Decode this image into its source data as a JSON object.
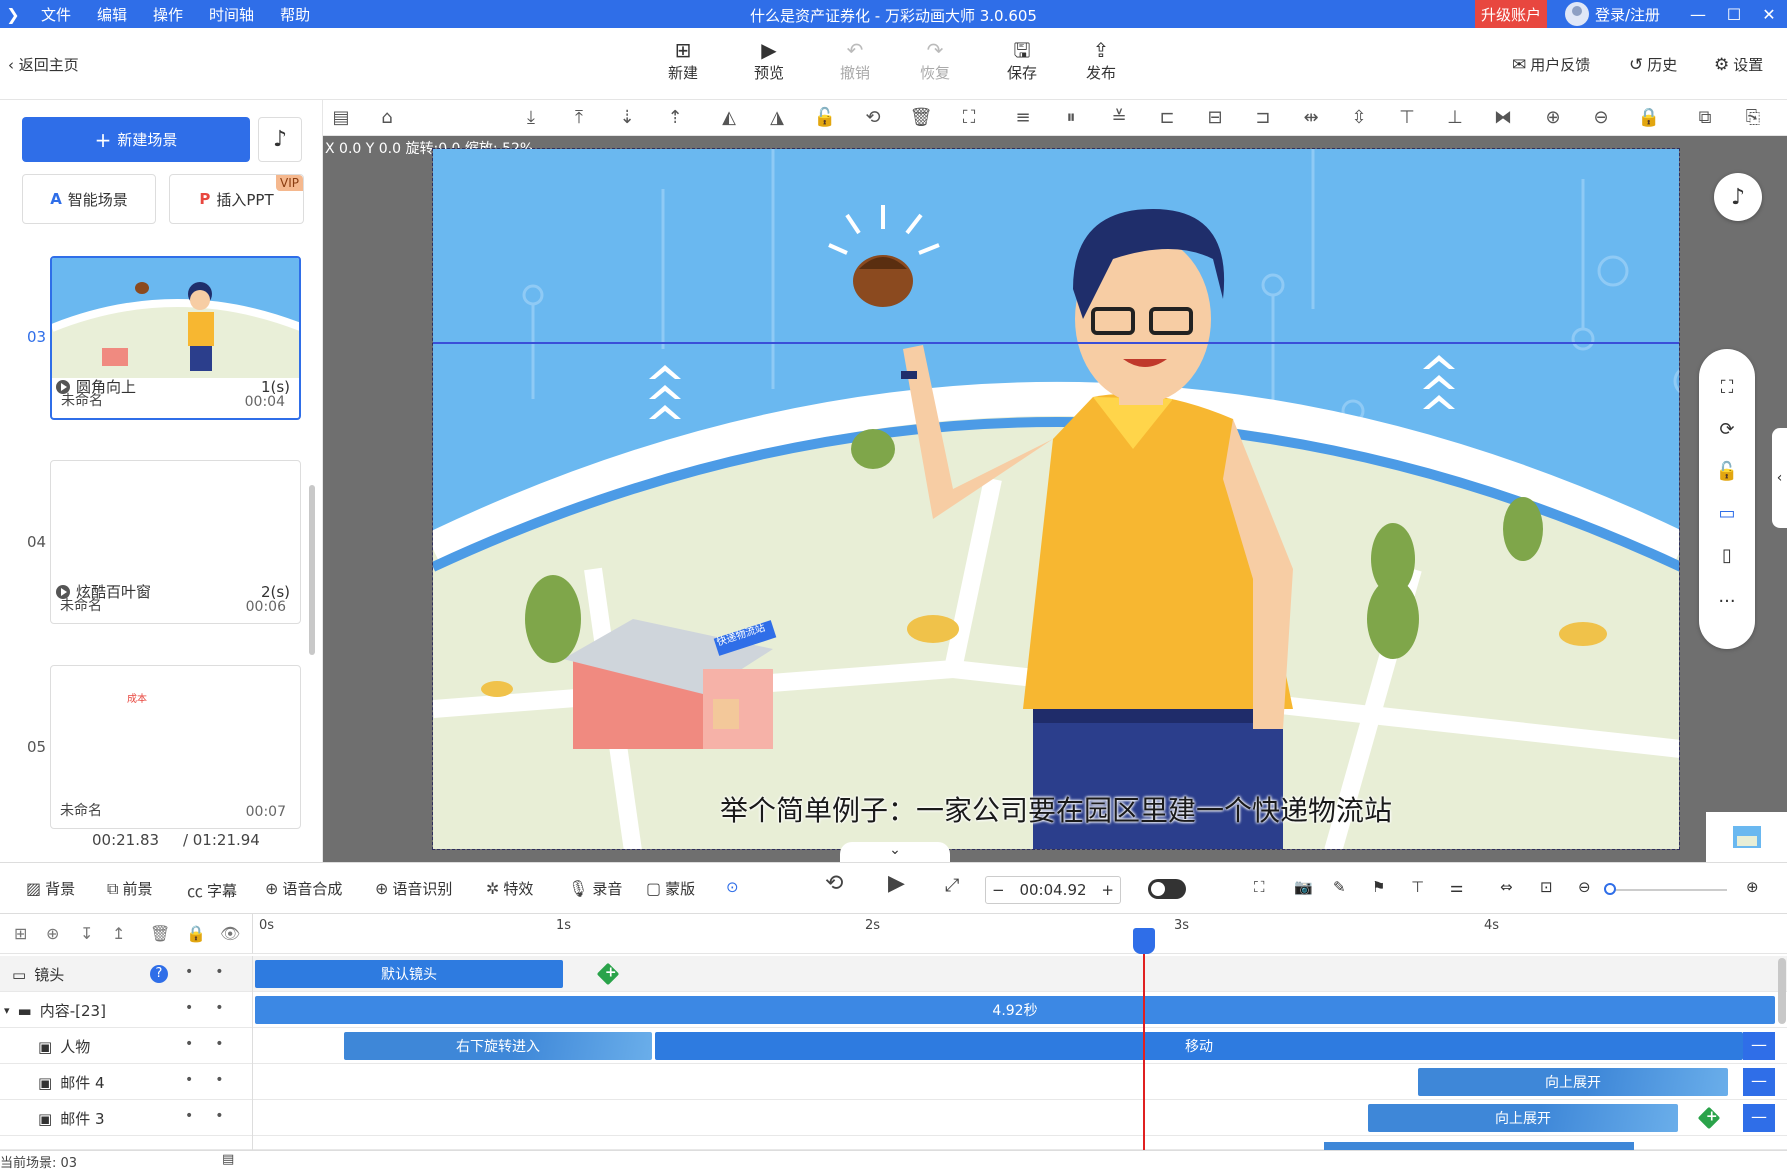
{
  "window": {
    "title": "什么是资产证券化 - 万彩动画大师 3.0.605",
    "menu": [
      "文件",
      "编辑",
      "操作",
      "时间轴",
      "帮助"
    ],
    "upgrade": "升级账户",
    "login": "登录/注册"
  },
  "toolbar": {
    "back": "返回主页",
    "new": "新建",
    "preview": "预览",
    "undo": "撤销",
    "redo": "恢复",
    "save": "保存",
    "publish": "发布",
    "feedback": "用户反馈",
    "history": "历史",
    "settings": "设置"
  },
  "left": {
    "new_scene": "新建场景",
    "smart_scene": "智能场景",
    "insert_ppt": "插入PPT",
    "vip": "VIP",
    "scenes": [
      {
        "num": "03",
        "name": "未命名",
        "time": "00:04",
        "transition": "圆角向上",
        "dur": "1(s)"
      },
      {
        "num": "04",
        "name": "未命名",
        "time": "00:06",
        "transition": "炫酷百叶窗",
        "dur": "2(s)"
      },
      {
        "num": "05",
        "name": "未命名",
        "time": "00:07"
      }
    ],
    "thumb5_text": "成本",
    "current_time": "00:21.83",
    "total_time": "/ 01:21.94"
  },
  "stage": {
    "coords": "X 0.0 Y 0.0 旋转:0.0 缩放: 52%",
    "subtitle": "举个简单例子：一家公司要在园区里建一个快递物流站",
    "building_sign": "快递物流站"
  },
  "controls": {
    "bg": "背景",
    "fg": "前景",
    "caption": "字幕",
    "tts": "语音合成",
    "asr": "语音识别",
    "fx": "特效",
    "record": "录音",
    "mask": "蒙版",
    "time": "00:04.92"
  },
  "timeline": {
    "ruler": [
      "0s",
      "1s",
      "2s",
      "3s",
      "4s"
    ],
    "tracks": [
      {
        "label": "镜头",
        "bars": [
          {
            "text": "默认镜头"
          }
        ]
      },
      {
        "label": "内容-[23]",
        "bars": [
          {
            "text": "4.92秒"
          }
        ]
      },
      {
        "label": "人物",
        "bars": [
          {
            "text": "右下旋转进入"
          },
          {
            "text": "移动"
          }
        ]
      },
      {
        "label": "邮件 4",
        "bars": [
          {
            "text": "向上展开"
          }
        ]
      },
      {
        "label": "邮件 3",
        "bars": [
          {
            "text": "向上展开"
          }
        ]
      }
    ],
    "current_scene": "当前场景: 03"
  },
  "colors": {
    "accent": "#2f6ee8",
    "sky": "#6ab8f0",
    "shirt": "#f7b731",
    "upgrade": "#e8473f"
  }
}
